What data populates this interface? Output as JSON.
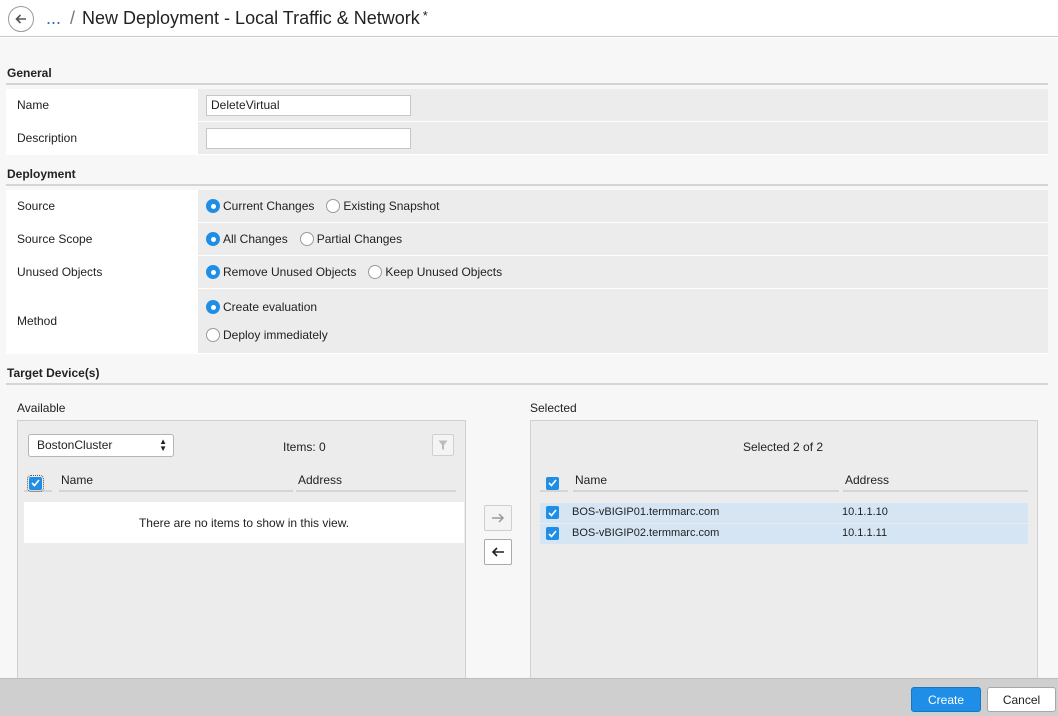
{
  "header": {
    "breadcrumb_ellipsis": "...",
    "separator": "/",
    "title": "New Deployment - Local Traffic & Network",
    "unsaved_marker": "*"
  },
  "general": {
    "heading": "General",
    "name_label": "Name",
    "name_value": "DeleteVirtual",
    "description_label": "Description",
    "description_value": ""
  },
  "deployment": {
    "heading": "Deployment",
    "source": {
      "label": "Source",
      "options": [
        "Current Changes",
        "Existing Snapshot"
      ],
      "selected": "Current Changes"
    },
    "source_scope": {
      "label": "Source Scope",
      "options": [
        "All Changes",
        "Partial Changes"
      ],
      "selected": "All Changes"
    },
    "unused_objects": {
      "label": "Unused Objects",
      "options": [
        "Remove Unused Objects",
        "Keep Unused Objects"
      ],
      "selected": "Remove Unused Objects"
    },
    "method": {
      "label": "Method",
      "options": [
        "Create evaluation",
        "Deploy immediately"
      ],
      "selected": "Create evaluation"
    }
  },
  "targets": {
    "heading": "Target Device(s)",
    "available": {
      "label": "Available",
      "cluster_select": "BostonCluster",
      "items_count": "Items: 0",
      "col_name": "Name",
      "col_address": "Address",
      "empty_message": "There are no items to show in this view."
    },
    "selected": {
      "label": "Selected",
      "summary": "Selected 2 of 2",
      "col_name": "Name",
      "col_address": "Address",
      "rows": [
        {
          "name": "BOS-vBIGIP01.termmarc.com",
          "address": "10.1.1.10"
        },
        {
          "name": "BOS-vBIGIP02.termmarc.com",
          "address": "10.1.1.11"
        }
      ]
    }
  },
  "footer": {
    "create_label": "Create",
    "cancel_label": "Cancel"
  },
  "colors": {
    "accent": "#1e8ee6",
    "selected_row": "#d6e5f4",
    "link": "#2a70c0"
  }
}
